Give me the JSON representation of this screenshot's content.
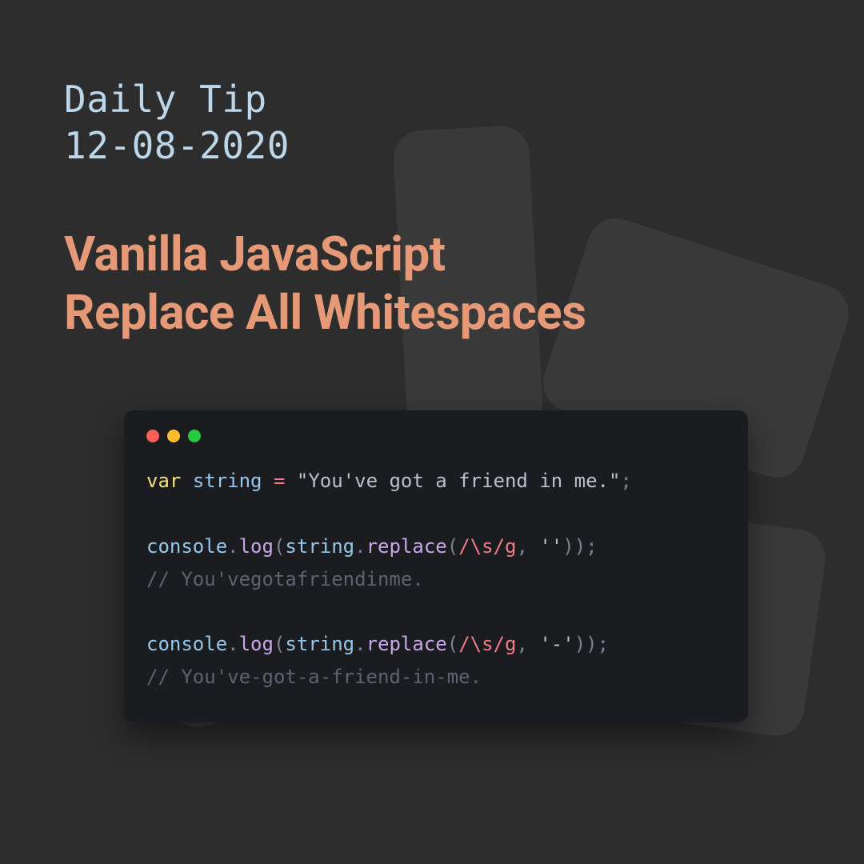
{
  "header": {
    "eyebrow_line1": "Daily Tip",
    "eyebrow_line2": "12-08-2020",
    "title_line1": "Vanilla JavaScript",
    "title_line2": "Replace All Whitespaces"
  },
  "traffic_lights": {
    "red": "#ff5f56",
    "yellow": "#ffbd2e",
    "green": "#27c93f"
  },
  "code": {
    "l1": {
      "kw": "var",
      "varname": "string",
      "assign": "=",
      "string": "\"You've got a friend in me.\"",
      "semi": ";"
    },
    "l2": {
      "obj": "console",
      "dot1": ".",
      "meth1": "log",
      "open1": "(",
      "arg": "string",
      "dot2": ".",
      "meth2": "replace",
      "open2": "(",
      "regex": "/\\s/g",
      "comma": ",",
      "repl": "''",
      "close": "));"
    },
    "c1": "// You'vegotafriendinme.",
    "l3": {
      "obj": "console",
      "dot1": ".",
      "meth1": "log",
      "open1": "(",
      "arg": "string",
      "dot2": ".",
      "meth2": "replace",
      "open2": "(",
      "regex": "/\\s/g",
      "comma": ",",
      "repl": "'-'",
      "close": "));"
    },
    "c2": "// You've-got-a-friend-in-me."
  }
}
